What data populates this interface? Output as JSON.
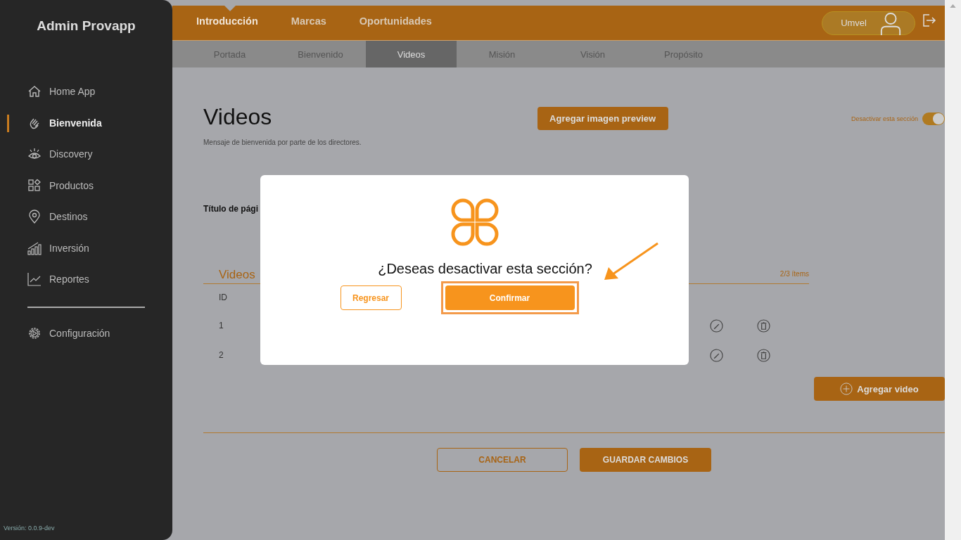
{
  "sidebar": {
    "title": "Admin Provapp",
    "items": [
      {
        "label": "Home App",
        "kind": "home",
        "selected": false
      },
      {
        "label": "Bienvenida",
        "kind": "hand",
        "selected": true
      },
      {
        "label": "Discovery",
        "kind": "eye",
        "selected": false
      },
      {
        "label": "Productos",
        "kind": "grid",
        "selected": false
      },
      {
        "label": "Destinos",
        "kind": "pin",
        "selected": false
      },
      {
        "label": "Inversión",
        "kind": "bars",
        "selected": false
      },
      {
        "label": "Reportes",
        "kind": "trend",
        "selected": false
      }
    ],
    "settings": {
      "label": "Configuración",
      "kind": "gear",
      "selected": false
    },
    "version": "Versión: 0.0.9-dev"
  },
  "top_nav": {
    "tabs": [
      {
        "label": "Introducción",
        "selected": true
      },
      {
        "label": "Marcas",
        "selected": false
      },
      {
        "label": "Oportunidades",
        "selected": false
      }
    ],
    "user": "Umvel"
  },
  "sub_nav": [
    {
      "label": "Portada",
      "selected": false
    },
    {
      "label": "Bienvenido",
      "selected": false
    },
    {
      "label": "Videos",
      "selected": true
    },
    {
      "label": "Misión",
      "selected": false
    },
    {
      "label": "Visión",
      "selected": false
    },
    {
      "label": "Propósito",
      "selected": false
    }
  ],
  "page": {
    "title": "Videos",
    "subtitle": "Mensaje de bienvenida por parte de los directores.",
    "preview_button": "Agregar imagen preview",
    "toggle": {
      "label": "Desactivar esta sección",
      "on": true
    },
    "field_label": "Título de pági",
    "videos": {
      "heading": "Videos",
      "count": "2/3 ítems",
      "columns": [
        "ID"
      ],
      "rows": [
        {
          "id": "1"
        },
        {
          "id": "2"
        }
      ]
    },
    "add_button": "Agregar video",
    "cancel": "CANCELAR",
    "save": "GUARDAR CAMBIOS"
  },
  "dialog": {
    "question": "¿Deseas desactivar esta sección?",
    "back": "Regresar",
    "confirm": "Confirmar"
  }
}
